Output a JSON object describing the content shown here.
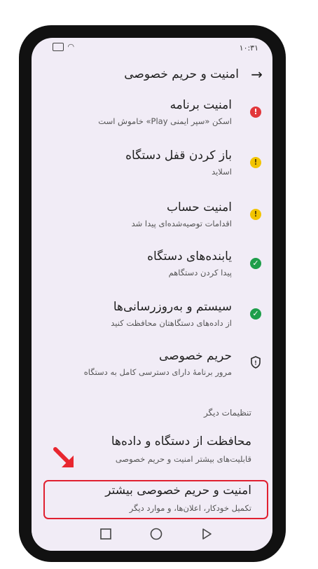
{
  "status": {
    "time": "۱۰:۳۱"
  },
  "header": {
    "title": "امنیت و حریم خصوصی"
  },
  "items": [
    {
      "title": "امنیت برنامه",
      "subtitle": "اسکن «سپر ایمنی Play» خاموش است",
      "status": "error",
      "icon": "exclamation-red-icon"
    },
    {
      "title": "باز کردن قفل دستگاه",
      "subtitle": "اسلاید",
      "status": "warning",
      "icon": "exclamation-yellow-icon"
    },
    {
      "title": "امنیت حساب",
      "subtitle": "اقدامات توصیه‌شده‌ای پیدا شد",
      "status": "warning",
      "icon": "exclamation-yellow-icon"
    },
    {
      "title": "یابنده‌های دستگاه",
      "subtitle": "پیدا کردن دستگاهم",
      "status": "ok",
      "icon": "check-green-icon"
    },
    {
      "title": "سیستم و به‌روزرسانی‌ها",
      "subtitle": "از داده‌های دستگاهتان محافظت کنید",
      "status": "ok",
      "icon": "check-green-icon"
    },
    {
      "title": "حریم خصوصی",
      "subtitle": "مرور برنامهٔ دارای دسترسی کامل به دستگاه",
      "status": "info",
      "icon": "shield-icon"
    }
  ],
  "other": {
    "label": "تنظیمات دیگر",
    "items": [
      {
        "title": "محافظت از دستگاه و داده‌ها",
        "subtitle": "قابلیت‌های بیشتر امنیت و حریم خصوصی"
      },
      {
        "title": "امنیت و حریم خصوصی بیشتر",
        "subtitle": "تکمیل خودکار، اعلان‌ها، و موارد دیگر"
      }
    ]
  },
  "colors": {
    "error": "#e2373b",
    "warning": "#f2c400",
    "ok": "#1e9e4a",
    "highlight": "#e02030"
  }
}
